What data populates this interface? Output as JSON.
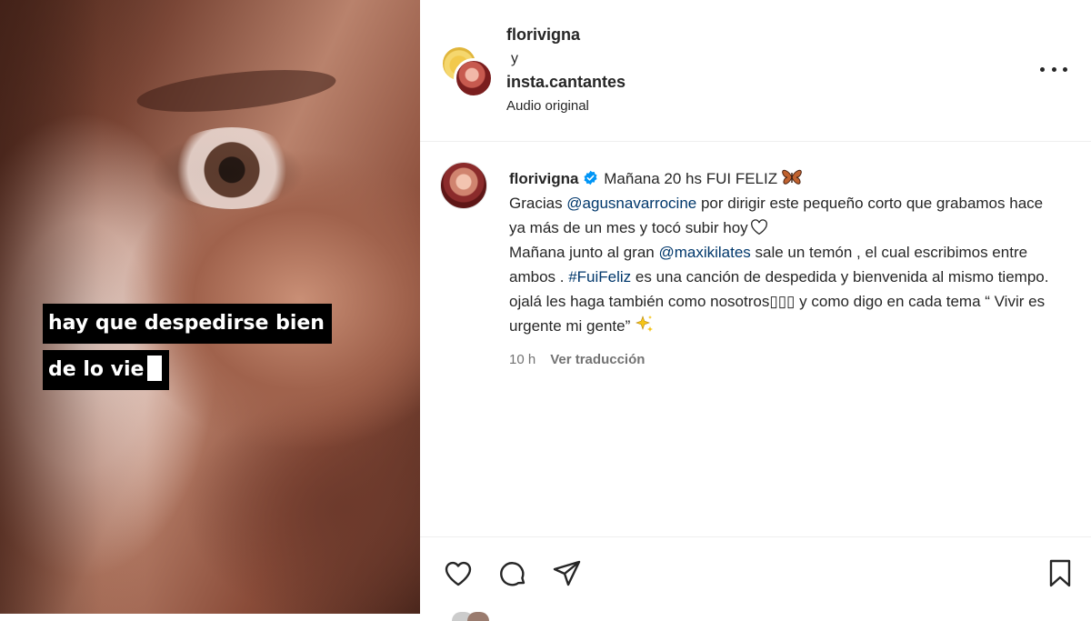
{
  "media": {
    "caption_line1": "hay que despedirse bien",
    "caption_line2": "de lo vie"
  },
  "header": {
    "user1": "florivigna",
    "connector": "y",
    "user2": "insta.cantantes",
    "audio": "Audio original",
    "more_icon": "more-horizontal-icon"
  },
  "comment": {
    "username": "florivigna",
    "line1_text": "Mañana 20 hs FUI FELIZ",
    "p1": "Gracias ",
    "mention1": "@agusnavarrocine",
    "p2": " por dirigir este pequeño corto que grabamos hace ya más de un mes y tocó subir hoy",
    "p3": "Mañana junto al gran ",
    "mention2": "@maxikilates",
    "p4": " sale un temón , el cual escribimos entre ambos . ",
    "hashtag": "#FuiFeliz",
    "p5": " es una canción de despedida y bienvenida al mismo tiempo. ojalá les haga también como nosotros",
    "boxes": "▯▯▯",
    "p6": " y como digo en cada tema “ Vivir es urgente mi gente”",
    "time": "10 h",
    "translate": "Ver traducción",
    "colors": {
      "link": "#00376b",
      "verified": "#0095f6",
      "meta": "#737373"
    }
  },
  "actions": {
    "icons": [
      "heart-icon",
      "comment-icon",
      "share-icon",
      "bookmark-icon"
    ]
  }
}
